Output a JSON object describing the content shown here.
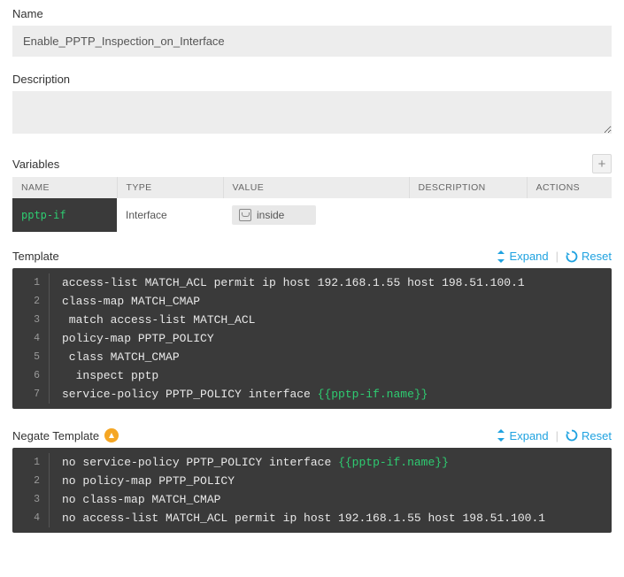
{
  "name": {
    "label": "Name",
    "value": "Enable_PPTP_Inspection_on_Interface"
  },
  "description": {
    "label": "Description",
    "value": ""
  },
  "variables": {
    "label": "Variables",
    "headers": {
      "name": "NAME",
      "type": "TYPE",
      "value": "VALUE",
      "description": "DESCRIPTION",
      "actions": "ACTIONS"
    },
    "rows": [
      {
        "name": "pptp-if",
        "type": "Interface",
        "value": "inside",
        "description": ""
      }
    ]
  },
  "template": {
    "label": "Template",
    "expand": "Expand",
    "reset": "Reset",
    "lines": [
      [
        {
          "t": "access-list MATCH_ACL permit ip host 192.168.1.55 host 198.51.100.1"
        }
      ],
      [
        {
          "t": "class-map MATCH_CMAP"
        }
      ],
      [
        {
          "t": " match access-list MATCH_ACL"
        }
      ],
      [
        {
          "t": "policy-map PPTP_POLICY"
        }
      ],
      [
        {
          "t": " class MATCH_CMAP"
        }
      ],
      [
        {
          "t": "  inspect pptp"
        }
      ],
      [
        {
          "t": "service-policy PPTP_POLICY interface "
        },
        {
          "t": "{{pptp-if.name}}",
          "c": "tok-var"
        }
      ]
    ]
  },
  "negate": {
    "label": "Negate Template",
    "expand": "Expand",
    "reset": "Reset",
    "lines": [
      [
        {
          "t": "no service-policy PPTP_POLICY interface "
        },
        {
          "t": "{{pptp-if.name}}",
          "c": "tok-var"
        }
      ],
      [
        {
          "t": "no policy-map PPTP_POLICY"
        }
      ],
      [
        {
          "t": "no class-map MATCH_CMAP"
        }
      ],
      [
        {
          "t": "no access-list MATCH_ACL permit ip host 192.168.1.55 host 198.51.100.1"
        }
      ]
    ]
  }
}
